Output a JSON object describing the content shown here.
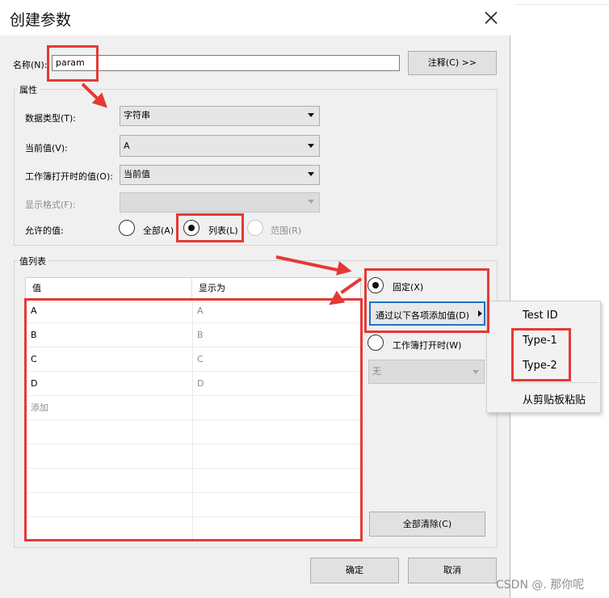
{
  "dialog": {
    "title": "创建参数"
  },
  "name_row": {
    "label": "名称(N):",
    "label_key": "N",
    "value": "param",
    "comment_button": "注释(C) >>"
  },
  "properties": {
    "group_title": "属性",
    "data_type": {
      "label": "数据类型(T):",
      "value": "字符串"
    },
    "current_value": {
      "label": "当前值(V):",
      "value": "A"
    },
    "on_open": {
      "label": "工作簿打开时的值(O):",
      "value": "当前值"
    },
    "display_format": {
      "label": "显示格式(F):",
      "value": ""
    },
    "allowed": {
      "label": "允许的值:",
      "all": "全部(A)",
      "list": "列表(L)",
      "range": "范围(R)",
      "selected": "list"
    }
  },
  "value_list": {
    "group_title": "值列表",
    "columns": [
      "值",
      "显示为"
    ],
    "rows": [
      {
        "value": "A",
        "display": "A"
      },
      {
        "value": "B",
        "display": "B"
      },
      {
        "value": "C",
        "display": "C"
      },
      {
        "value": "D",
        "display": "D"
      }
    ],
    "add_placeholder": "添加",
    "fixed_label": "固定(X)",
    "add_from_button": "通过以下各项添加值(D)",
    "on_open_label": "工作簿打开时(W)",
    "on_open_combo": "无",
    "clear_all": "全部清除(C)"
  },
  "context_menu": {
    "items": [
      "Test ID",
      "Type-1",
      "Type-2",
      "从剪贴板粘贴"
    ]
  },
  "buttons": {
    "ok": "确定",
    "cancel": "取消"
  },
  "watermark": "CSDN @. 那你呢",
  "colors": {
    "annotation_red": "#e53935",
    "focus_blue": "#1e73c8"
  }
}
